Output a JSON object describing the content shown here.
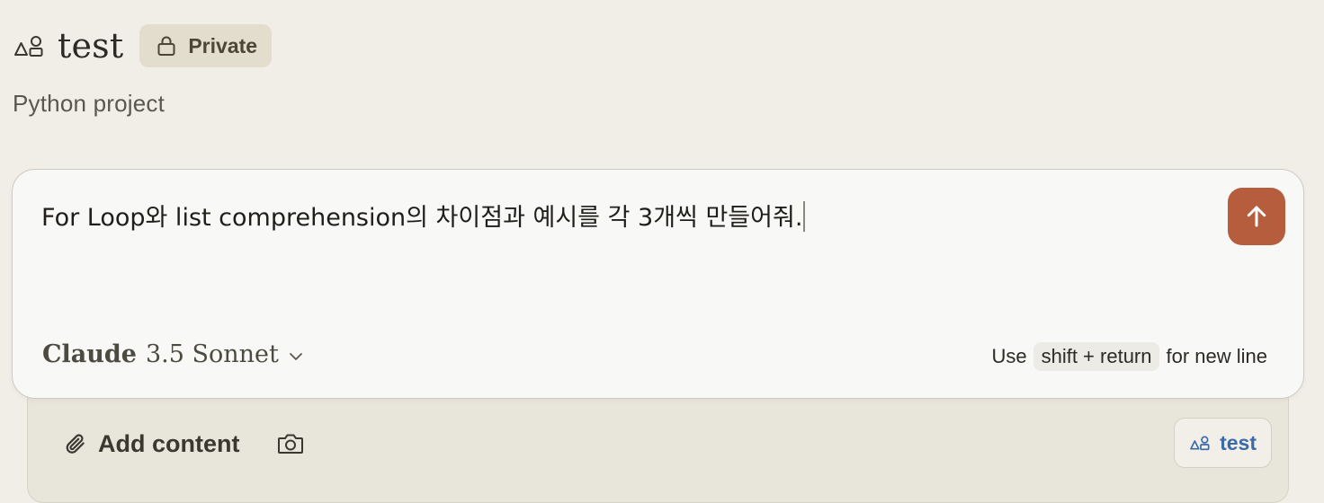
{
  "project": {
    "title": "test",
    "visibility": "Private",
    "description": "Python project"
  },
  "composer": {
    "input_value": "For Loop와 list comprehension의 차이점과 예시를 각 3개씩 만들어줘.",
    "model_brand": "Claude",
    "model_name": "3.5 Sonnet",
    "hint": {
      "prefix": "Use",
      "key": "shift + return",
      "suffix": "for new line"
    },
    "send_color": "#b65d3e"
  },
  "tray": {
    "add_content_label": "Add content",
    "project_chip_label": "test",
    "chip_color": "#3b6aa8"
  },
  "icons": {
    "project": "shapes-icon",
    "lock": "lock-icon",
    "send": "arrow-up-icon",
    "chevron": "chevron-down-icon",
    "attach": "paperclip-icon",
    "camera": "camera-icon"
  }
}
